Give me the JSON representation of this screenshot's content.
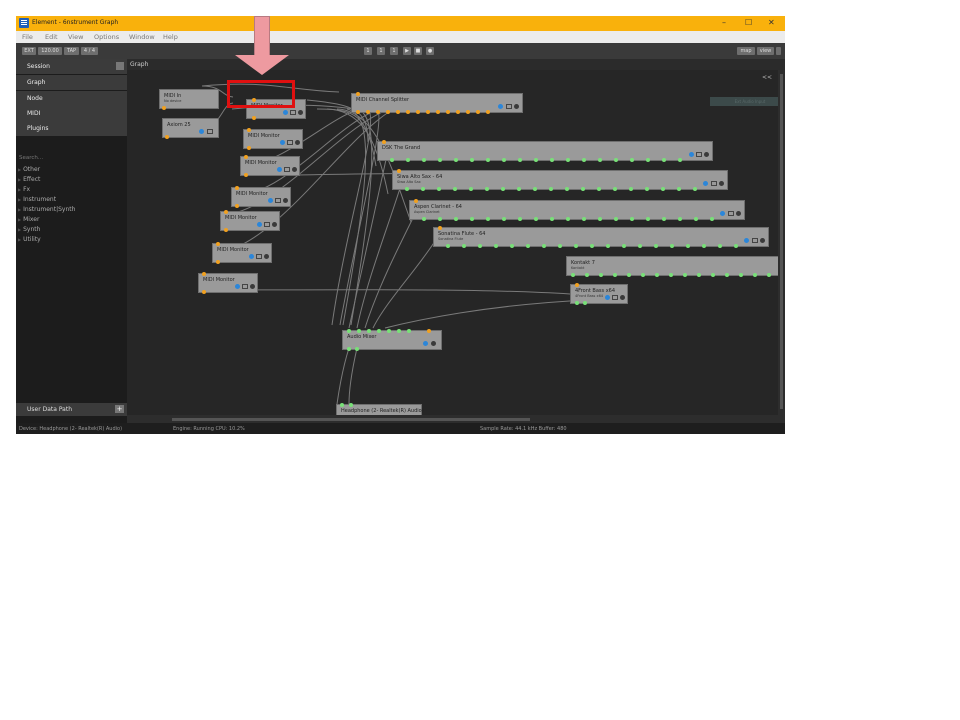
{
  "window": {
    "title": "Element - 6nstrument Graph",
    "controls": [
      "–",
      "☐",
      "✕"
    ]
  },
  "menu": [
    "File",
    "Edit",
    "View",
    "Options",
    "Window",
    "Help"
  ],
  "toolbar": {
    "ext": "EXT",
    "tempo": "120.00",
    "tap": "TAP",
    "meter": "4 / 4",
    "transport": [
      "1",
      "1",
      "1",
      "▶",
      "■",
      "●"
    ],
    "map": "map",
    "view": "view"
  },
  "sidebar": {
    "items": [
      {
        "label": "Session"
      },
      {
        "label": "Graph"
      },
      {
        "label": "Node"
      },
      {
        "label": "MIDI"
      },
      {
        "label": "Plugins"
      }
    ],
    "search_placeholder": "Search...",
    "plugins": [
      "Other",
      "Effect",
      "Fx",
      "Instrument",
      "Instrument|Synth",
      "Mixer",
      "Synth",
      "Utility"
    ],
    "user_data_path": "User Data Path",
    "add": "+"
  },
  "graph": {
    "header": "Graph",
    "collapse": "<<",
    "ghost_label": "Ext Audio Input",
    "nodes": [
      {
        "title": "MIDI In",
        "sub": "No device"
      },
      {
        "title": "Axiom 25",
        "sub": ""
      },
      {
        "title": "MIDI Monitor",
        "sub": ""
      },
      {
        "title": "MIDI Monitor",
        "sub": ""
      },
      {
        "title": "MIDI Monitor",
        "sub": ""
      },
      {
        "title": "MIDI Monitor",
        "sub": ""
      },
      {
        "title": "MIDI Monitor",
        "sub": ""
      },
      {
        "title": "MIDI Monitor",
        "sub": ""
      },
      {
        "title": "MIDI Monitor",
        "sub": ""
      },
      {
        "title": "MIDI Channel Splitter",
        "sub": ""
      },
      {
        "title": "DSK The Grand",
        "sub": ""
      },
      {
        "title": "Siwa Alto Sax - 64",
        "sub": "Siwa Alto Sax"
      },
      {
        "title": "Aspen Clarinet - 64",
        "sub": "Aspen Clarinet"
      },
      {
        "title": "Sonatina Flute - 64",
        "sub": "Sonatina Flute"
      },
      {
        "title": "Kontakt 7",
        "sub": "Kontakt"
      },
      {
        "title": "4Front Bass x64",
        "sub": "4Front Bass x64"
      },
      {
        "title": "Audio Mixer",
        "sub": ""
      },
      {
        "title": "Headphone (2- Realtek(R) Audio)",
        "sub": ""
      }
    ]
  },
  "status": {
    "device": "Device: Headphone (2- Realtek(R) Audio)",
    "engine": "Engine: Running   CPU: 10.2%",
    "sample": "Sample Rate: 44.1 kHz   Buffer: 480"
  },
  "colors": {
    "titlebar": "#f9b10c",
    "midi_port": "#f0a020",
    "audio_port": "#78e078",
    "power_icon": "#2b86d9",
    "highlight": "#e01010",
    "arrow": "#ee9aa0"
  },
  "annotation": {
    "highlighted_node": "MIDI Monitor"
  }
}
